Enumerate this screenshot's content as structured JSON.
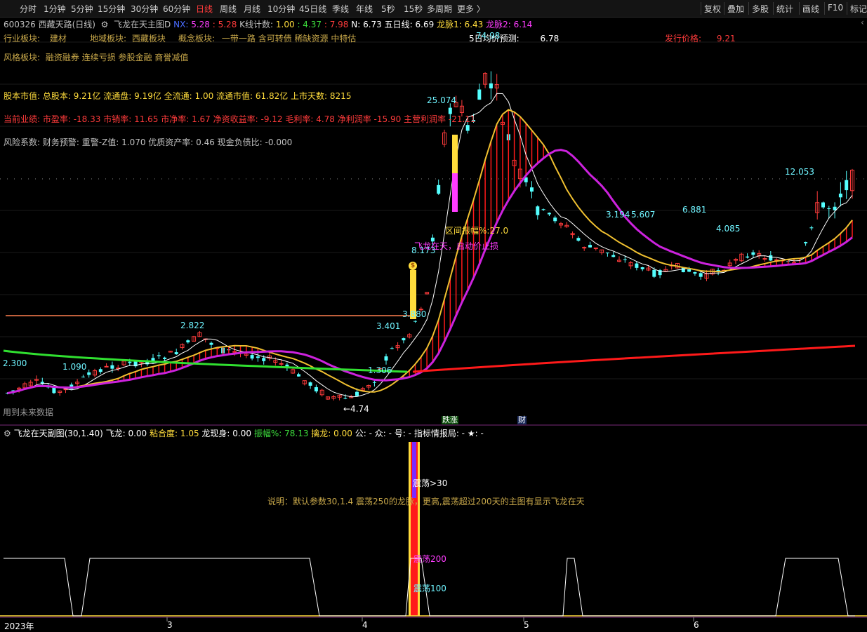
{
  "toolbar": {
    "periods": [
      "分时",
      "1分钟",
      "5分钟",
      "15分钟",
      "30分钟",
      "60分钟",
      "日线",
      "周线",
      "月线",
      "10分钟",
      "45日线",
      "季线",
      "年线",
      "5秒",
      "15秒",
      "多周期",
      "更多 〉"
    ],
    "active_period": "日线",
    "right": [
      "复权",
      "叠加",
      "多股",
      "统计",
      "画线",
      "F10",
      "标记"
    ]
  },
  "header": {
    "code_name": "600326 西藏天路(日线)",
    "indicator_name": "飞龙在天主图D",
    "nx_label": "NX:",
    "nx_val1": "5.28",
    "nx_val2": ": 5.28",
    "kcount_label": "K线计数:",
    "kcount_val": "1.00",
    "v1": ": 4.37",
    "v2": ": 7.98",
    "n_label": "N: 6.73",
    "wuri_label": "五日线: 6.69",
    "longmai1": "龙脉1: 6.43",
    "longmai2": "龙脉2: 6.14"
  },
  "info": {
    "industry_label": "行业板块:",
    "industry_val": "建材",
    "region_label": "地域板块:",
    "region_val": "西藏板块",
    "concept_label": "概念板块:",
    "concept_val": "一带一路 含可转债 稀缺资源 中特估",
    "forecast_label": "5日均价预测:",
    "forecast_val": "6.78",
    "issue_label": "发行价格:",
    "issue_val": "9.21",
    "style_label": "风格板块:",
    "style_val": "融资融券 连续亏损 参股金融 商誉减值",
    "capital": "股本市值: 总股本: 9.21亿 流通盘: 9.19亿 全流通: 1.00 流通市值: 61.82亿 上市天数: 8215",
    "perf": "当前业绩: 市盈率: -18.33 市销率: 11.65 市净率: 1.67 净资收益率: -9.12 毛利率: 4.78 净利润率 -15.90 主营利润率 -21.11",
    "risk": "风险系数: 财务预警: 重警-Z值: 1.070 优质资产率: 0.46 现金负债比: -0.000"
  },
  "annotations": {
    "p2300": "2.300",
    "p1090": "1.090",
    "p2822": "2.822",
    "p1306": "1.306",
    "p3401": "3.401",
    "p3880": "3.880",
    "p8173": "8.173",
    "p25074": "25.074",
    "p7498": "74.98",
    "p3194": "3.194",
    "p5607": "5.607",
    "p6881": "6.881",
    "p4085": "4.085",
    "p12053": "12.053",
    "low474": "←4.74",
    "range_amp": "区间振幅%:27.0",
    "flying": "飞龙在天，启动价止损",
    "use_hint": "用到未来数据",
    "diezhang": "跌涨",
    "cai": "财",
    "money_icon": "$"
  },
  "sub_header": {
    "title": "飞龙在天副图(30,1.40)",
    "feilong": "飞龙: 0.00",
    "nianhe_label": "粘合度:",
    "nianhe_val": "1.05",
    "xianshen": "龙现身: 0.00",
    "zhenfu_label": "振幅%:",
    "zhenfu_val": "78.13",
    "qinlong_label": "擒龙:",
    "qinlong_val": "0.00",
    "gong": "公: -",
    "zhong": "众: -",
    "hao": "号: -",
    "zhibiao": "指标情报局: -",
    "star": "★: -"
  },
  "sub": {
    "zd30": "震荡>30",
    "desc": "说明：默认参数30,1.4 震荡250的龙脉，更高,震荡超过200天的主图有显示飞龙在天",
    "zd200": "震荡200",
    "zd100": "震荡100"
  },
  "axis": {
    "year": "2023年",
    "m3": "3",
    "m4": "4",
    "m5": "5",
    "m6": "6"
  },
  "colors": {
    "up": "#ff3b3b",
    "down": "#54ffff",
    "magenta": "#cc22dd",
    "gold": "#f0c030",
    "green": "#30e030",
    "red_line": "#ff1a1a"
  }
}
